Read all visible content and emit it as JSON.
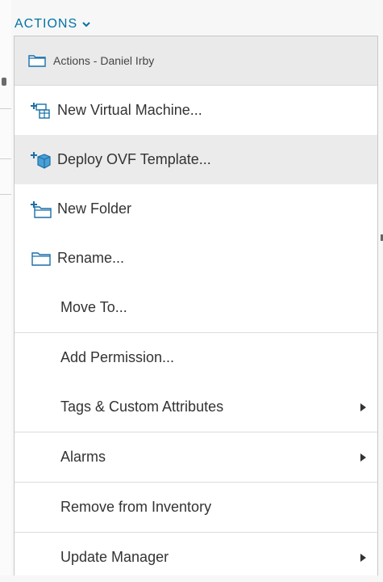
{
  "actions_button": {
    "label": "ACTIONS"
  },
  "menu": {
    "header": {
      "label": "Actions - Daniel Irby",
      "icon": "folder-icon"
    },
    "items": [
      {
        "label": "New Virtual Machine...",
        "icon": "new-vm-icon"
      },
      {
        "label": "Deploy OVF Template...",
        "icon": "deploy-ovf-icon"
      },
      {
        "label": "New Folder",
        "icon": "new-folder-icon"
      },
      {
        "label": "Rename...",
        "icon": "folder-icon"
      },
      {
        "label": "Move To..."
      },
      {
        "label": "Add Permission..."
      },
      {
        "label": "Tags & Custom Attributes",
        "submenu": true
      },
      {
        "label": "Alarms",
        "submenu": true
      },
      {
        "label": "Remove from Inventory"
      },
      {
        "label": "Update Manager",
        "submenu": true
      }
    ]
  },
  "colors": {
    "link": "#0072a3",
    "icon_blue": "#1a6fa8",
    "hover": "#ebebeb",
    "header_bg": "#eaeaea"
  }
}
